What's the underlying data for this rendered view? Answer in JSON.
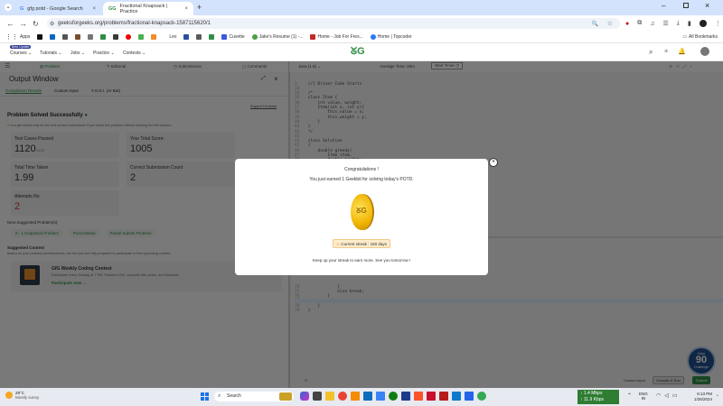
{
  "browser": {
    "tabs": [
      {
        "label": "gfg potd - Google Search"
      },
      {
        "label": "Fractional Knapsack | Practice"
      }
    ],
    "url": "geeksforgeeks.org/problems/fractional-knapsack-1587115620/1",
    "all_bookmarks": "All Bookmarks",
    "bookmarks": [
      {
        "label": "Apps"
      },
      {
        "label": "Lex"
      },
      {
        "label": "Cuvette"
      },
      {
        "label": "Jake's Resume (1) -..."
      },
      {
        "label": "Home - Job For Fres..."
      },
      {
        "label": "Home | Topcoder"
      }
    ]
  },
  "site": {
    "nav": [
      "Courses",
      "Tutorials",
      "Jobs",
      "Practice",
      "Contests"
    ],
    "new_badge": "Beta Update",
    "subnav": [
      "Problem",
      "Editorial",
      "Submissions",
      "Comments"
    ]
  },
  "output": {
    "title": "Output Window",
    "tabs": [
      "Compilation Results",
      "Custom Input",
      "Y.O.G.I. (AI Bot)"
    ],
    "suggest_link": "Suggest Feedback",
    "solved": "Problem Solved Successfully",
    "note": "You get marks only for the first correct submission if you solve the problem without viewing the full solution.",
    "stats": [
      {
        "label": "Test Cases Passed",
        "value": "1120",
        "sub": "/1120",
        "color": "#333"
      },
      {
        "label": "Your Total Score:",
        "value": "1005",
        "sub": "",
        "color": "#333"
      },
      {
        "label": "Total Time Taken",
        "value": "1.99",
        "sub": "",
        "color": "#333"
      },
      {
        "label": "Correct Submission Count",
        "value": "2",
        "sub": "",
        "color": "#333"
      },
      {
        "label": "Attempts No.",
        "value": "2",
        "sub": "",
        "color": "#c0392b"
      }
    ],
    "next_label": "Next Suggested Problem(s):",
    "next": [
      "0 - 1 Knapsack Problem",
      "Pizza Mania",
      "Partial Subset Problem"
    ],
    "contest_heading": "Suggested Contest",
    "contest_note": "Based on your problem performances, we feel you are fully prepared to participate in this upcoming contest.",
    "contest_title": "GfG Weekly Coding Contest",
    "contest_desc": "Participate every Sunday at 7 PM. Practice DSA, compete with peers, win Rewards!",
    "contest_link": "Participate now →"
  },
  "editor": {
    "lang": "Java (1.8)",
    "avg_time": "Average Time: 20m",
    "timer": "Start Timer",
    "lines_top": [
      {
        "n": "1",
        "t": "//{ Driver Code Starts"
      },
      {
        "n": "33",
        "t": ""
      },
      {
        "n": "34",
        "t": "/*"
      },
      {
        "n": "35",
        "t": "class Item {"
      },
      {
        "n": "36",
        "t": "    int value, weight;"
      },
      {
        "n": "37",
        "t": "    Item(int x, int y){"
      },
      {
        "n": "38",
        "t": "        this.value = x;"
      },
      {
        "n": "39",
        "t": "        this.weight = y;"
      },
      {
        "n": "40",
        "t": "    }"
      },
      {
        "n": "41",
        "t": "}"
      },
      {
        "n": "42",
        "t": "*/"
      },
      {
        "n": "43",
        "t": ""
      },
      {
        "n": "44",
        "t": "class Solution"
      },
      {
        "n": "45",
        "t": "{"
      },
      {
        "n": "46",
        "t": "    double greedy("
      },
      {
        "n": "47",
        "t": "        Item item,"
      },
      {
        "n": "48",
        "t": "        double profit;"
      }
    ],
    "lines_bottom": [
      {
        "n": "74",
        "t": "            }"
      },
      {
        "n": "75",
        "t": "            else break;"
      },
      {
        "n": "76",
        "t": "        }"
      },
      {
        "n": "77",
        "t": "        return ans;"
      },
      {
        "n": "78",
        "t": "    }"
      },
      {
        "n": "79",
        "t": "}"
      }
    ],
    "custom_input": "Custom Input",
    "compile": "Compile & Run",
    "submit": "Submit",
    "badge_num": "90",
    "badge_top": "Days",
    "badge_bottom": "Challenge"
  },
  "modal": {
    "title": "Congratulations !",
    "msg": "You just earned 1 Geekbit for solving today's POTD.",
    "streak": "Current streak : 160 days",
    "foot": "Keep up your streak to earn more. See you tomorrow !",
    "close": "×"
  },
  "taskbar": {
    "temp": "29°C",
    "weather": "Mostly sunny",
    "search": "Search",
    "net_down": "↓ 1.4 Mbps",
    "net_up": "↑ 11.9 Kbps",
    "lang1": "ENG",
    "lang2": "IN",
    "time": "6:13 PM",
    "date": "1/26/2024"
  }
}
